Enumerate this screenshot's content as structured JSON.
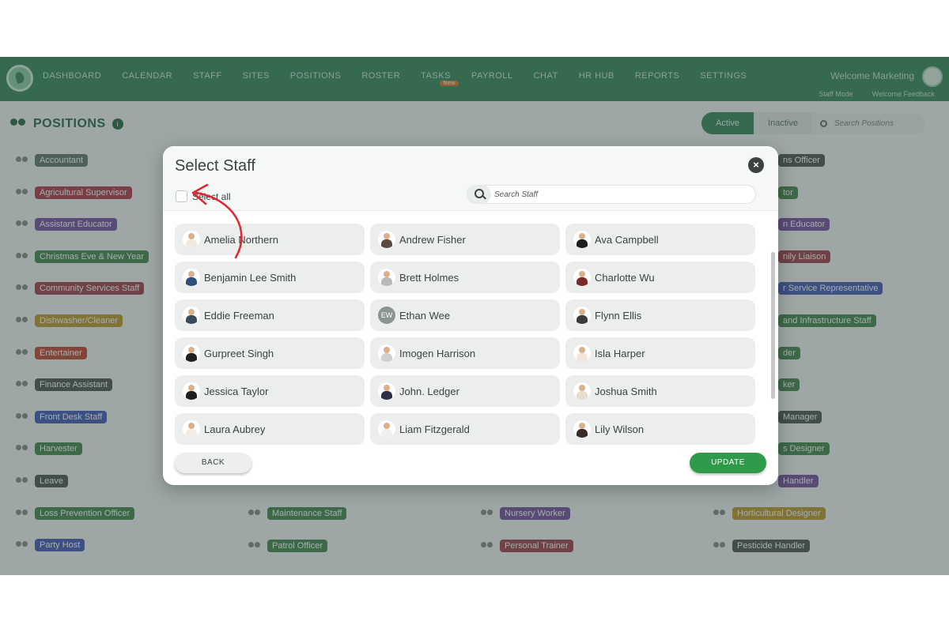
{
  "nav": {
    "items": [
      "DASHBOARD",
      "CALENDAR",
      "STAFF",
      "SITES",
      "POSITIONS",
      "ROSTER",
      "TASKS",
      "PAYROLL",
      "CHAT",
      "HR HUB",
      "REPORTS",
      "SETTINGS"
    ],
    "tasks_badge": "New",
    "welcome": "Welcome Marketing",
    "sub_links": [
      "Staff Mode",
      "Welcome Feedback"
    ]
  },
  "positions": {
    "title": "POSITIONS",
    "info": "i",
    "tabs": {
      "active": "Active",
      "inactive": "Inactive"
    },
    "search_placeholder": "Search Positions",
    "items": [
      {
        "label": "Accountant",
        "color": "#6a7a74"
      },
      {
        "label": "Agricultural Supervisor",
        "color": "#b3424f"
      },
      {
        "label": "Assistant Educator",
        "color": "#7b57a3"
      },
      {
        "label": "Christmas Eve & New Year",
        "color": "#4e8a57"
      },
      {
        "label": "Community Services Staff",
        "color": "#a34753"
      },
      {
        "label": "Dishwasher/Cleaner",
        "color": "#c29a3a"
      },
      {
        "label": "Entertainer",
        "color": "#c24f3a"
      },
      {
        "label": "Finance Assistant",
        "color": "#555c59"
      },
      {
        "label": "Front Desk Staff",
        "color": "#4f5fb8"
      },
      {
        "label": "Harvester",
        "color": "#4e8a57"
      },
      {
        "label": "Leave",
        "color": "#555c59"
      },
      {
        "label": "Loss Prevention Officer",
        "color": "#4e8a57"
      },
      {
        "label": "Party Host",
        "color": "#4f5fb8"
      },
      {
        "label": "Maintenance Staff",
        "color": "#4e8a57"
      },
      {
        "label": "Patrol Officer",
        "color": "#4e8a57"
      },
      {
        "label": "Nursery Worker",
        "color": "#7b57a3"
      },
      {
        "label": "Personal Trainer",
        "color": "#a34753"
      },
      {
        "label": "Pesticide Handler",
        "color": "#555c59"
      },
      {
        "label": "ns Officer",
        "color": "#555c59"
      },
      {
        "label": "tor",
        "color": "#4e8a57"
      },
      {
        "label": "n Educator",
        "color": "#7b57a3"
      },
      {
        "label": "nily Liaison",
        "color": "#a34753"
      },
      {
        "label": "r Service Representative",
        "color": "#4f5fb8"
      },
      {
        "label": "and Infrastructure Staff",
        "color": "#4e8a57"
      },
      {
        "label": "der",
        "color": "#4e8a57"
      },
      {
        "label": "ker",
        "color": "#4e8a57"
      },
      {
        "label": "Manager",
        "color": "#555c59"
      },
      {
        "label": "s Designer",
        "color": "#4e8a57"
      },
      {
        "label": "Handler",
        "color": "#7b57a3"
      },
      {
        "label": "Horticultural Designer",
        "color": "#c29a3a"
      }
    ]
  },
  "modal": {
    "title": "Select Staff",
    "close_label": "×",
    "select_all": "Select all",
    "search_placeholder": "Search Staff",
    "staff": [
      {
        "name": "Amelia Northern",
        "avatar": "photo",
        "shirt": "#f1e9df"
      },
      {
        "name": "Andrew Fisher",
        "avatar": "photo",
        "shirt": "#5a4a42"
      },
      {
        "name": "Ava Campbell",
        "avatar": "photo",
        "shirt": "#1e1e1e"
      },
      {
        "name": "Benjamin Lee Smith",
        "avatar": "photo",
        "shirt": "#2d4f7a"
      },
      {
        "name": "Brett Holmes",
        "avatar": "photo",
        "shirt": "#b9b9b9"
      },
      {
        "name": "Charlotte Wu",
        "avatar": "photo",
        "shirt": "#7a2a2a"
      },
      {
        "name": "Eddie Freeman",
        "avatar": "photo",
        "shirt": "#3a4a5a"
      },
      {
        "name": "Ethan Wee",
        "avatar": "initials",
        "initials": "EW"
      },
      {
        "name": "Flynn Ellis",
        "avatar": "photo",
        "shirt": "#3a3a3a"
      },
      {
        "name": "Gurpreet Singh",
        "avatar": "photo",
        "shirt": "#202020"
      },
      {
        "name": "Imogen Harrison",
        "avatar": "photo",
        "shirt": "#d0d0d0"
      },
      {
        "name": "Isla Harper",
        "avatar": "photo",
        "shirt": "#f2e4d8"
      },
      {
        "name": "Jessica Taylor",
        "avatar": "photo",
        "shirt": "#1e1e1e"
      },
      {
        "name": "John. Ledger",
        "avatar": "photo",
        "shirt": "#2a2f45"
      },
      {
        "name": "Joshua Smith",
        "avatar": "photo",
        "shirt": "#e8dccb"
      },
      {
        "name": "Laura Aubrey",
        "avatar": "photo",
        "shirt": "#f3ece4"
      },
      {
        "name": "Liam Fitzgerald",
        "avatar": "photo",
        "shirt": "#f0f0f0"
      },
      {
        "name": "Lily Wilson",
        "avatar": "photo",
        "shirt": "#3a2a2a"
      }
    ],
    "back_label": "BACK",
    "update_label": "UPDATE"
  },
  "colors": {
    "accent_green": "#3e8a63",
    "update_green": "#2f9a49",
    "annotation_red": "#e0262e"
  }
}
